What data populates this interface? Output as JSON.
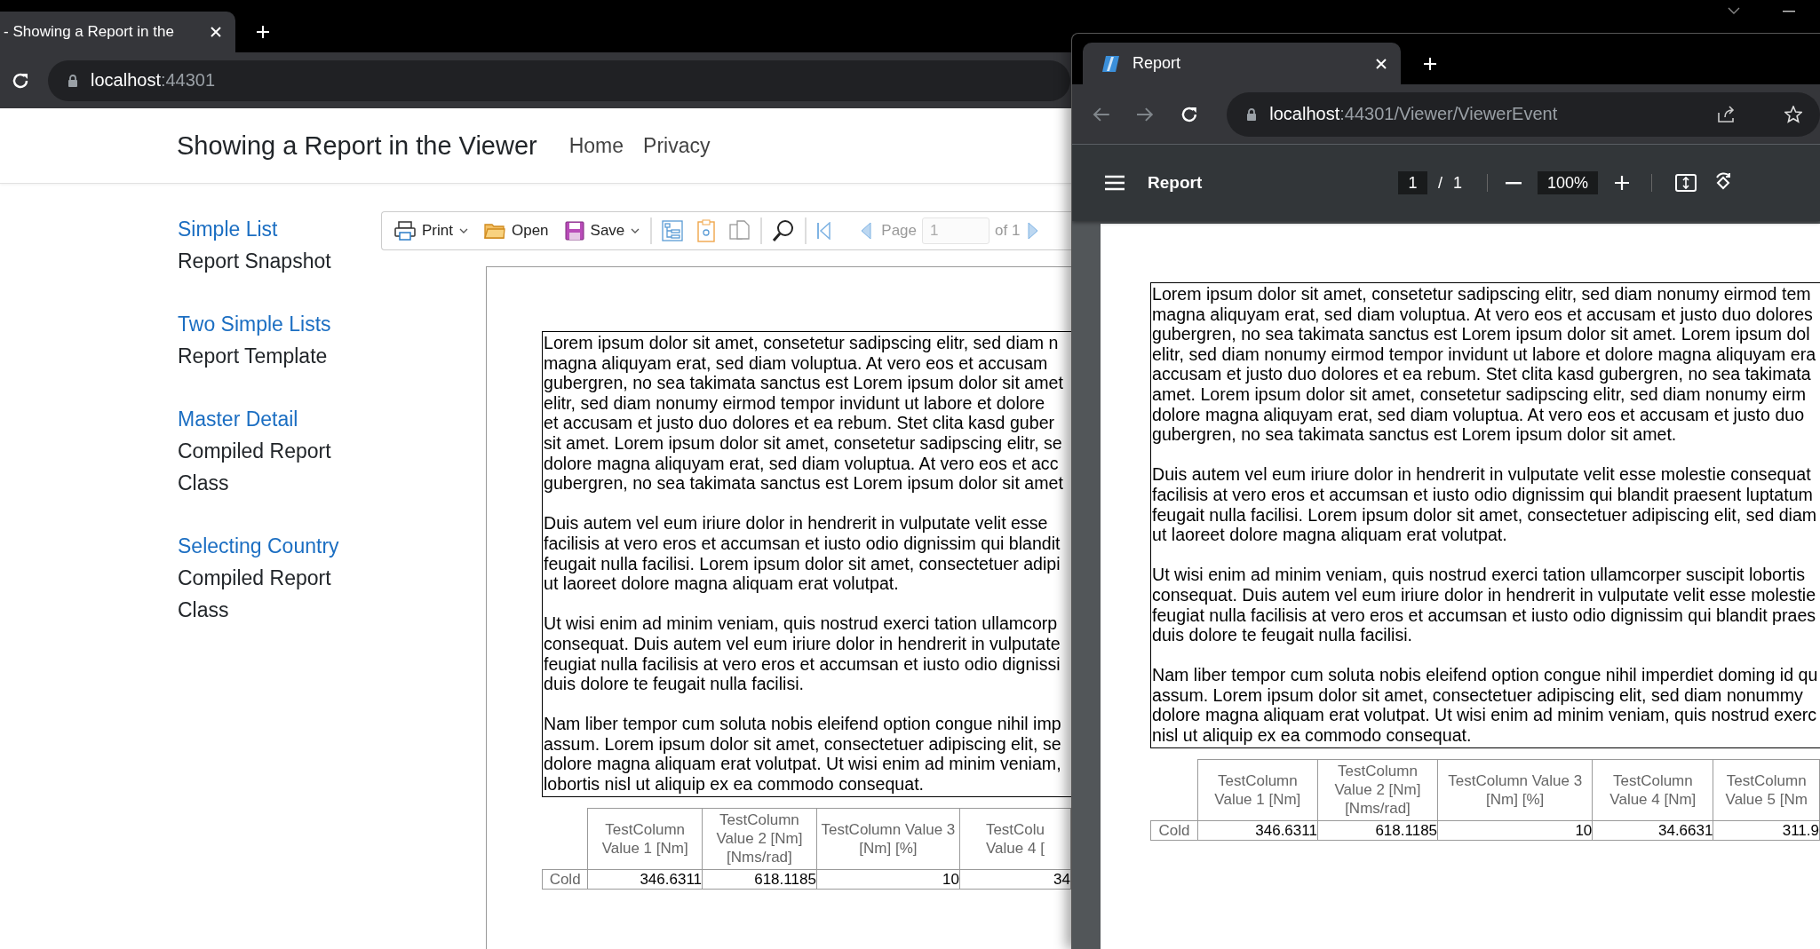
{
  "back_window": {
    "tab_title": "- Showing a Report in the",
    "address": {
      "host": "localhost",
      "rest": ":44301"
    },
    "site": {
      "brand": "Showing a Report in the Viewer",
      "nav": [
        {
          "label": "Home"
        },
        {
          "label": "Privacy"
        }
      ]
    },
    "sidebar": [
      {
        "link": "Simple List",
        "caption": "Report Snapshot"
      },
      {
        "link": "Two Simple Lists",
        "caption": "Report Template"
      },
      {
        "link": "Master Detail",
        "caption": "Compiled Report Class"
      },
      {
        "link": "Selecting Country",
        "caption": "Compiled Report Class"
      }
    ],
    "viewer_toolbar": {
      "buttons": [
        {
          "label": "Print",
          "kind": "print",
          "dropdown": true
        },
        {
          "label": "Open",
          "kind": "open",
          "dropdown": false
        },
        {
          "label": "Save",
          "kind": "save",
          "dropdown": true
        }
      ],
      "page_label": "Page",
      "page_value": "1",
      "page_total": "of 1"
    },
    "report": {
      "paragraphs": [
        [
          "Lorem ipsum dolor sit amet, consetetur sadipscing elitr, sed diam n",
          "magna aliquyam erat, sed diam voluptua. At vero eos et accusam",
          "gubergren, no sea takimata sanctus est Lorem ipsum dolor sit amet",
          "elitr, sed diam nonumy eirmod tempor invidunt ut labore et dolore",
          "et accusam et justo duo dolores et ea rebum. Stet clita kasd guber",
          "sit amet. Lorem ipsum dolor sit amet, consetetur sadipscing elitr, se",
          "dolore magna aliquyam erat, sed diam voluptua. At vero eos et acc",
          "gubergren, no sea takimata sanctus est Lorem ipsum dolor sit amet"
        ],
        [
          "Duis autem vel eum iriure dolor in hendrerit in vulputate velit esse",
          "facilisis at vero eros et accumsan et iusto odio dignissim qui blandit",
          "feugait nulla facilisi. Lorem ipsum dolor sit amet, consectetuer adipi",
          "ut laoreet dolore magna aliquam erat volutpat."
        ],
        [
          "Ut wisi enim ad minim veniam, quis nostrud exerci tation ullamcorp",
          "consequat. Duis autem vel eum iriure dolor in hendrerit in vulputate",
          "feugiat nulla facilisis at vero eros et accumsan et iusto odio dignissi",
          "duis dolore te feugait nulla facilisi."
        ],
        [
          "Nam liber tempor cum soluta nobis eleifend option congue nihil imp",
          "assum. Lorem ipsum dolor sit amet, consectetuer adipiscing elit, se",
          "dolore magna aliquam erat volutpat. Ut wisi enim ad minim veniam,",
          "lobortis nisl ut aliquip ex ea commodo consequat."
        ]
      ],
      "table": {
        "columns": [
          "TestColumn\nValue 1 [Nm]",
          "TestColumn\nValue 2 [Nm]\n[Nms/rad]",
          "TestColumn Value 3\n[Nm] [%]",
          "TestColu\nValue 4 ["
        ],
        "rows": [
          {
            "label": "Cold",
            "cells": [
              "346.6311",
              "618.1185",
              "10",
              "34"
            ]
          }
        ]
      }
    }
  },
  "front_window": {
    "tab_title": "Report",
    "address": {
      "host": "localhost",
      "rest": ":44301/Viewer/ViewerEvent"
    },
    "pdf_toolbar": {
      "title": "Report",
      "page": "1",
      "separator": "/",
      "total": "1",
      "zoom": "100%"
    },
    "report": {
      "paragraphs": [
        [
          "Lorem ipsum dolor sit amet, consetetur sadipscing elitr, sed diam nonumy eirmod tem",
          "magna aliquyam erat, sed diam voluptua. At vero eos et accusam et justo duo dolores",
          "gubergren, no sea takimata sanctus est Lorem ipsum dolor sit amet. Lorem ipsum dol",
          "elitr, sed diam nonumy eirmod tempor invidunt ut labore et dolore magna aliquyam era",
          "accusam et justo duo dolores et ea rebum. Stet clita kasd gubergren, no sea takimata",
          "amet. Lorem ipsum dolor sit amet, consetetur sadipscing elitr, sed diam nonumy eirm",
          "dolore magna aliquyam erat, sed diam voluptua. At vero eos et accusam et justo duo",
          "gubergren, no sea takimata sanctus est Lorem ipsum dolor sit amet."
        ],
        [
          "Duis autem vel eum iriure dolor in hendrerit in vulputate velit esse molestie consequat",
          "facilisis at vero eros et accumsan et iusto odio dignissim qui blandit praesent luptatum",
          "feugait nulla facilisi. Lorem ipsum dolor sit amet, consectetuer adipiscing elit, sed diam",
          "ut laoreet dolore magna aliquam erat volutpat."
        ],
        [
          "Ut wisi enim ad minim veniam, quis nostrud exerci tation ullamcorper suscipit lobortis",
          "consequat. Duis autem vel eum iriure dolor in hendrerit in vulputate velit esse molestie",
          "feugiat nulla facilisis at vero eros et accumsan et iusto odio dignissim qui blandit praes",
          "duis dolore te feugait nulla facilisi."
        ],
        [
          "Nam liber tempor cum soluta nobis eleifend option congue nihil imperdiet doming id qu",
          "assum. Lorem ipsum dolor sit amet, consectetuer adipiscing elit, sed diam nonummy",
          "dolore magna aliquam erat volutpat. Ut wisi enim ad minim veniam, quis nostrud exerc",
          "nisl ut aliquip ex ea commodo consequat."
        ]
      ],
      "table": {
        "columns": [
          "TestColumn\nValue 1 [Nm]",
          "TestColumn\nValue 2 [Nm]\n[Nms/rad]",
          "TestColumn Value 3\n[Nm] [%]",
          "TestColumn\nValue 4 [Nm]",
          "TestColumn\nValue 5 [Nm"
        ],
        "rows": [
          {
            "label": "Cold",
            "cells": [
              "346.6311",
              "618.1185",
              "10",
              "34.6631",
              "311.9"
            ]
          }
        ]
      }
    }
  }
}
